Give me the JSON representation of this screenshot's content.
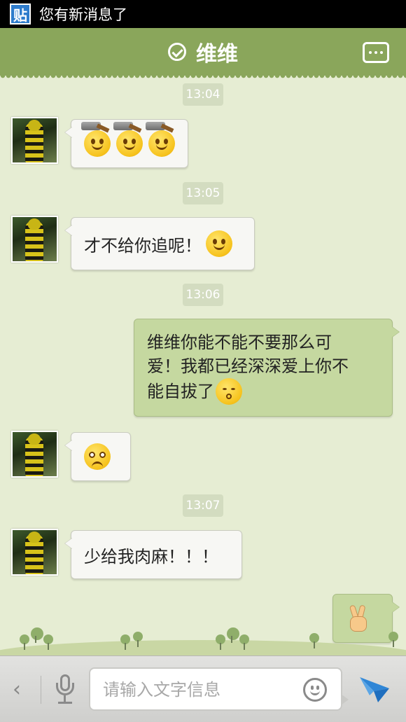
{
  "status_bar": {
    "notification_icon_text": "贴",
    "notification_text": "您有新消息了"
  },
  "header": {
    "title": "维维"
  },
  "messages": [
    {
      "type": "time",
      "text": "13:04"
    },
    {
      "type": "in",
      "content": "emoji",
      "emojis": [
        "hammer-face-emoji",
        "hammer-face-emoji",
        "hammer-face-emoji"
      ]
    },
    {
      "type": "time",
      "text": "13:05"
    },
    {
      "type": "in",
      "text": "才不给你追呢！",
      "emojis": [
        "smile-emoji"
      ]
    },
    {
      "type": "time",
      "text": "13:06"
    },
    {
      "type": "out",
      "lines": [
        "维维你能不能不要那么可",
        "爱！我都已经深深爱上你不",
        "能自拔了"
      ],
      "emojis": [
        "kiss-emoji"
      ]
    },
    {
      "type": "in",
      "content": "emoji",
      "emojis": [
        "teary-face-emoji"
      ]
    },
    {
      "type": "time",
      "text": "13:07"
    },
    {
      "type": "in",
      "text": "少给我肉麻！！！"
    },
    {
      "type": "out",
      "content": "emoji",
      "emojis": [
        "victory-hand-emoji"
      ]
    }
  ],
  "input_bar": {
    "placeholder": "请输入文字信息"
  },
  "colors": {
    "header_green": "#8aa65b",
    "background": "#e6edd3",
    "outgoing_bubble": "#c5d8a0",
    "incoming_bubble": "#f7f7f4",
    "send_blue": "#2f86d6"
  }
}
